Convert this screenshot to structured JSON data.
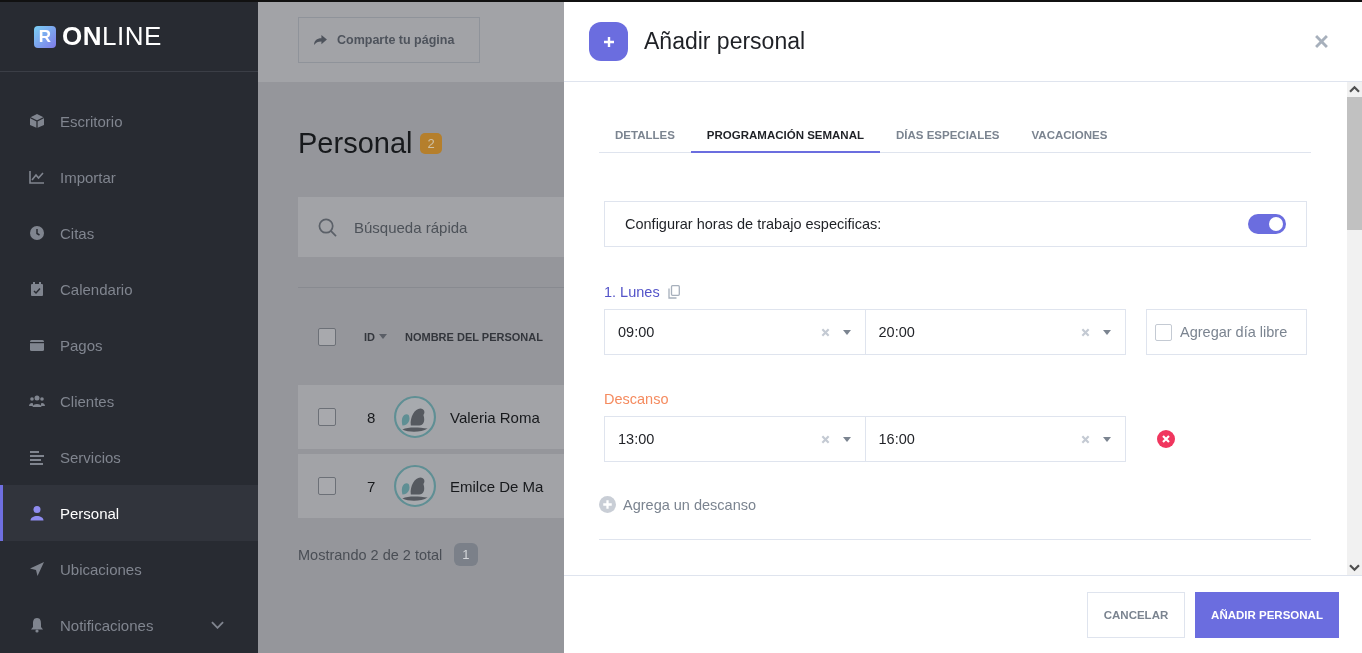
{
  "sidebar": {
    "logo": {
      "mark": "R",
      "bold": "ON",
      "light": "LINE"
    },
    "items": [
      {
        "label": "Escritorio",
        "selected": false,
        "submenu": false
      },
      {
        "label": "Importar",
        "selected": false,
        "submenu": false
      },
      {
        "label": "Citas",
        "selected": false,
        "submenu": false
      },
      {
        "label": "Calendario",
        "selected": false,
        "submenu": false
      },
      {
        "label": "Pagos",
        "selected": false,
        "submenu": false
      },
      {
        "label": "Clientes",
        "selected": false,
        "submenu": false
      },
      {
        "label": "Servicios",
        "selected": false,
        "submenu": false
      },
      {
        "label": "Personal",
        "selected": true,
        "submenu": false
      },
      {
        "label": "Ubicaciones",
        "selected": false,
        "submenu": false
      },
      {
        "label": "Notificaciones",
        "selected": false,
        "submenu": true
      }
    ]
  },
  "page": {
    "share_button": "Comparte tu página",
    "title": "Personal",
    "count": "2",
    "search": {
      "placeholder": "Búsqueda rápida"
    },
    "table": {
      "header_checked": false,
      "columns": [
        "ID",
        "NOMBRE DEL PERSONAL"
      ],
      "rows": [
        {
          "id": "8",
          "name": "Valeria Roma",
          "checked": false
        },
        {
          "id": "7",
          "name": "Emilce De Ma",
          "checked": false
        }
      ]
    },
    "footer": "Mostrando 2 de 2 total",
    "current_page": "1"
  },
  "modal": {
    "title": "Añadir personal",
    "tabs": [
      {
        "label": "DETALLES",
        "selected": false
      },
      {
        "label": "PROGRAMACIÓN SEMANAL",
        "selected": true
      },
      {
        "label": "DÍAS ESPECIALES",
        "selected": false
      },
      {
        "label": "VACACIONES",
        "selected": false
      }
    ],
    "toggle": {
      "label": "Configurar horas de trabajo especificas:",
      "on": true
    },
    "day": {
      "label": "1. Lunes",
      "start": "09:00",
      "end": "20:00",
      "day_off": {
        "label": "Agregar día libre",
        "checked": false
      }
    },
    "breaks_label": "Descanso",
    "breaks": [
      {
        "start": "13:00",
        "end": "16:00"
      }
    ],
    "add_break": "Agrega un descanso",
    "buttons": {
      "cancel": "CANCELAR",
      "submit": "AÑADIR PERSONAL"
    }
  }
}
